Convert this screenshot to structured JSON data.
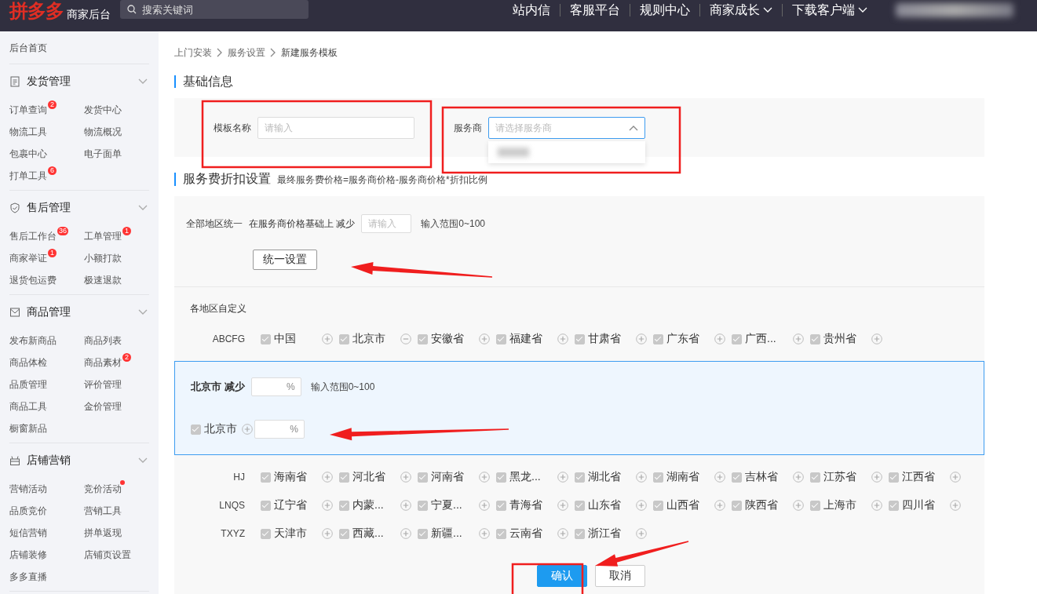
{
  "topbar": {
    "logo": "拼多多",
    "product": "商家后台",
    "search": {
      "placeholder": "搜索关键词"
    },
    "nav": [
      {
        "label": "站内信",
        "dropdown": false
      },
      {
        "label": "客服平台",
        "dropdown": false
      },
      {
        "label": "规则中心",
        "dropdown": false
      },
      {
        "label": "商家成长",
        "dropdown": true
      },
      {
        "label": "下载客户端",
        "dropdown": true
      }
    ]
  },
  "sidebar": {
    "home": "后台首页",
    "groups": [
      {
        "title": "发货管理",
        "expanded": true,
        "items": [
          {
            "label": "订单查询",
            "badge": "2"
          },
          {
            "label": "发货中心"
          },
          {
            "label": "物流工具"
          },
          {
            "label": "物流概况"
          },
          {
            "label": "包裹中心"
          },
          {
            "label": "电子面单"
          },
          {
            "label": "打单工具",
            "badge": "6"
          }
        ]
      },
      {
        "title": "售后管理",
        "expanded": true,
        "items": [
          {
            "label": "售后工作台",
            "badge": "36"
          },
          {
            "label": "工单管理",
            "badge": "1"
          },
          {
            "label": "商家举证",
            "badge": "1"
          },
          {
            "label": "小额打款"
          },
          {
            "label": "退货包运费"
          },
          {
            "label": "极速退款"
          }
        ]
      },
      {
        "title": "商品管理",
        "expanded": true,
        "items": [
          {
            "label": "发布新商品"
          },
          {
            "label": "商品列表"
          },
          {
            "label": "商品体检"
          },
          {
            "label": "商品素材",
            "badge": "2"
          },
          {
            "label": "品质管理"
          },
          {
            "label": "评价管理"
          },
          {
            "label": "商品工具"
          },
          {
            "label": "金价管理"
          },
          {
            "label": "橱窗新品"
          }
        ]
      },
      {
        "title": "店铺营销",
        "expanded": true,
        "items": [
          {
            "label": "营销活动",
            "dot": false
          },
          {
            "label": "竞价活动",
            "dot": true
          },
          {
            "label": "品质竞价"
          },
          {
            "label": "营销工具"
          },
          {
            "label": "短信营销"
          },
          {
            "label": "拼单返现"
          },
          {
            "label": "店铺装修"
          },
          {
            "label": "店铺页设置"
          },
          {
            "label": "多多直播"
          }
        ]
      }
    ]
  },
  "breadcrumb": [
    "上门安装",
    "服务设置",
    "新建服务模板"
  ],
  "basic": {
    "title": "基础信息",
    "template_name": {
      "label": "模板名称",
      "placeholder": "请输入"
    },
    "provider": {
      "label": "服务商",
      "placeholder": "请选择服务商",
      "expanded": true
    }
  },
  "discount": {
    "title": "服务费折扣设置",
    "note": "最终服务费价格=服务商价格-服务商价格*折扣比例",
    "unified": {
      "label": "全部地区统一",
      "prefix": "在服务商价格基础上 减少",
      "placeholder": "请输入",
      "range": "输入范围0~100",
      "button": "统一设置"
    },
    "custom": {
      "label": "各地区自定义",
      "groups": [
        {
          "label": "ABCFG",
          "regions": [
            {
              "name": "中国",
              "checked": true,
              "expanded": false
            },
            {
              "name": "北京市",
              "checked": true,
              "expanded": true
            },
            {
              "name": "安徽省",
              "checked": true,
              "expanded": false
            },
            {
              "name": "福建省",
              "checked": true,
              "expanded": false
            },
            {
              "name": "甘肃省",
              "checked": true,
              "expanded": false
            },
            {
              "name": "广东省",
              "checked": true,
              "expanded": false
            },
            {
              "name": "广西...",
              "checked": true,
              "expanded": false
            },
            {
              "name": "贵州省",
              "checked": true,
              "expanded": false
            }
          ],
          "detail": {
            "title": "北京市 减少",
            "unit": "%",
            "range": "输入范围0~100",
            "items": [
              {
                "name": "北京市",
                "checked": true,
                "expanded": false,
                "unit": "%"
              }
            ]
          }
        },
        {
          "label": "HJ",
          "regions": [
            {
              "name": "海南省",
              "checked": true,
              "expanded": false
            },
            {
              "name": "河北省",
              "checked": true,
              "expanded": false
            },
            {
              "name": "河南省",
              "checked": true,
              "expanded": false
            },
            {
              "name": "黑龙...",
              "checked": true,
              "expanded": false
            },
            {
              "name": "湖北省",
              "checked": true,
              "expanded": false
            },
            {
              "name": "湖南省",
              "checked": true,
              "expanded": false
            },
            {
              "name": "吉林省",
              "checked": true,
              "expanded": false
            },
            {
              "name": "江苏省",
              "checked": true,
              "expanded": false
            },
            {
              "name": "江西省",
              "checked": true,
              "expanded": false
            }
          ]
        },
        {
          "label": "LNQS",
          "regions": [
            {
              "name": "辽宁省",
              "checked": true,
              "expanded": false
            },
            {
              "name": "内蒙...",
              "checked": true,
              "expanded": false
            },
            {
              "name": "宁夏...",
              "checked": true,
              "expanded": false
            },
            {
              "name": "青海省",
              "checked": true,
              "expanded": false
            },
            {
              "name": "山东省",
              "checked": true,
              "expanded": false
            },
            {
              "name": "山西省",
              "checked": true,
              "expanded": false
            },
            {
              "name": "陕西省",
              "checked": true,
              "expanded": false
            },
            {
              "name": "上海市",
              "checked": true,
              "expanded": false
            },
            {
              "name": "四川省",
              "checked": true,
              "expanded": false
            }
          ]
        },
        {
          "label": "TXYZ",
          "regions": [
            {
              "name": "天津市",
              "checked": true,
              "expanded": false
            },
            {
              "name": "西藏...",
              "checked": true,
              "expanded": false
            },
            {
              "name": "新疆...",
              "checked": true,
              "expanded": false
            },
            {
              "name": "云南省",
              "checked": true,
              "expanded": false
            },
            {
              "name": "浙江省",
              "checked": true,
              "expanded": false
            }
          ]
        }
      ]
    }
  },
  "actions": [
    {
      "label": "确认",
      "primary": true
    },
    {
      "label": "取消",
      "primary": false
    }
  ]
}
